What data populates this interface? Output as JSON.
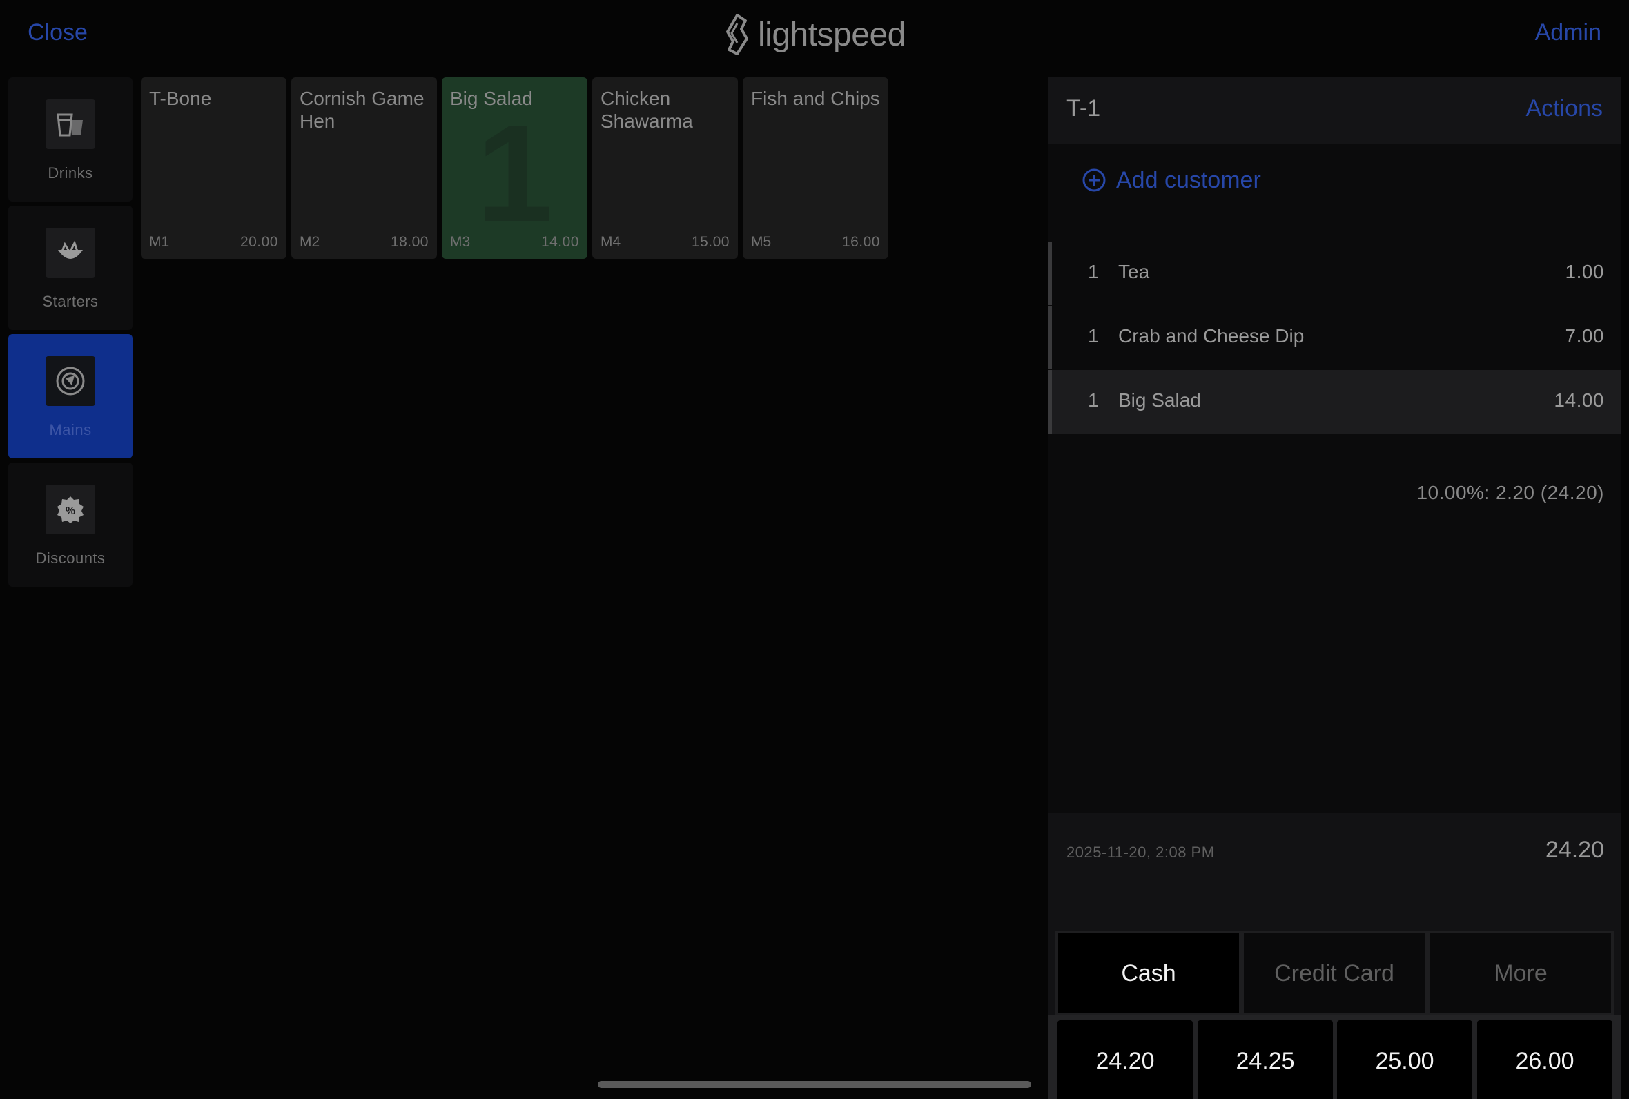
{
  "topbar": {
    "close_label": "Close",
    "admin_label": "Admin",
    "logo_text": "lightspeed"
  },
  "categories": [
    {
      "label": "Drinks",
      "icon": "drink-icon",
      "active": false
    },
    {
      "label": "Starters",
      "icon": "starter-icon",
      "active": false
    },
    {
      "label": "Mains",
      "icon": "mains-icon",
      "active": true
    },
    {
      "label": "Discounts",
      "icon": "discount-icon",
      "active": false
    }
  ],
  "products": [
    {
      "name": "T-Bone",
      "code": "M1",
      "price": "20.00",
      "selected": false,
      "qty": ""
    },
    {
      "name": "Cornish Game Hen",
      "code": "M2",
      "price": "18.00",
      "selected": false,
      "qty": ""
    },
    {
      "name": "Big Salad",
      "code": "M3",
      "price": "14.00",
      "selected": true,
      "qty": "1"
    },
    {
      "name": "Chicken Shawarma",
      "code": "M4",
      "price": "15.00",
      "selected": false,
      "qty": ""
    },
    {
      "name": "Fish and Chips",
      "code": "M5",
      "price": "16.00",
      "selected": false,
      "qty": ""
    }
  ],
  "order": {
    "title": "T-1",
    "actions_label": "Actions",
    "add_customer_label": "Add customer",
    "lines": [
      {
        "qty": "1",
        "name": "Tea",
        "price": "1.00",
        "selected": false
      },
      {
        "qty": "1",
        "name": "Crab and Cheese Dip",
        "price": "7.00",
        "selected": false
      },
      {
        "qty": "1",
        "name": "Big Salad",
        "price": "14.00",
        "selected": true
      }
    ],
    "tax_summary": "10.00%: 2.20 (24.20)",
    "timestamp": "2025-11-20, 2:08 PM",
    "total": "24.20"
  },
  "payment": {
    "methods": [
      {
        "label": "Cash",
        "active": true
      },
      {
        "label": "Credit Card",
        "active": false
      },
      {
        "label": "More",
        "active": false
      }
    ],
    "quick_amounts": [
      "24.20",
      "24.25",
      "25.00",
      "26.00"
    ]
  },
  "colors": {
    "accent": "#2747a8",
    "active_category": "#0f2f8c",
    "selected_tile": "#1d3a26"
  }
}
